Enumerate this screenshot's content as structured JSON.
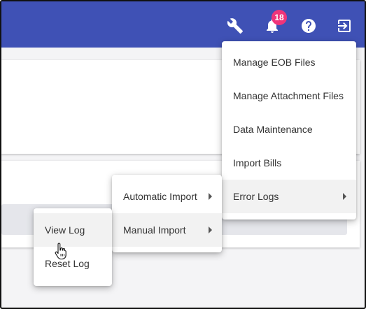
{
  "header": {
    "notification_count": "18",
    "icons": [
      "wrench-icon",
      "bell-icon",
      "help-icon",
      "logout-icon"
    ]
  },
  "main_menu": {
    "items": [
      {
        "label": "Manage EOB Files"
      },
      {
        "label": "Manage Attachment Files"
      },
      {
        "label": "Data Maintenance"
      },
      {
        "label": "Import Bills"
      },
      {
        "label": "Error Logs",
        "has_submenu": true
      }
    ]
  },
  "error_logs_submenu": {
    "items": [
      {
        "label": "Automatic Import",
        "has_submenu": true
      },
      {
        "label": "Manual Import",
        "has_submenu": true
      }
    ]
  },
  "manual_import_submenu": {
    "items": [
      {
        "label": "View Log"
      },
      {
        "label": "Reset Log"
      }
    ]
  },
  "colors": {
    "header_bg": "#3f51b5",
    "badge_bg": "#f0347a",
    "hover_bg": "#f2f2f2"
  }
}
